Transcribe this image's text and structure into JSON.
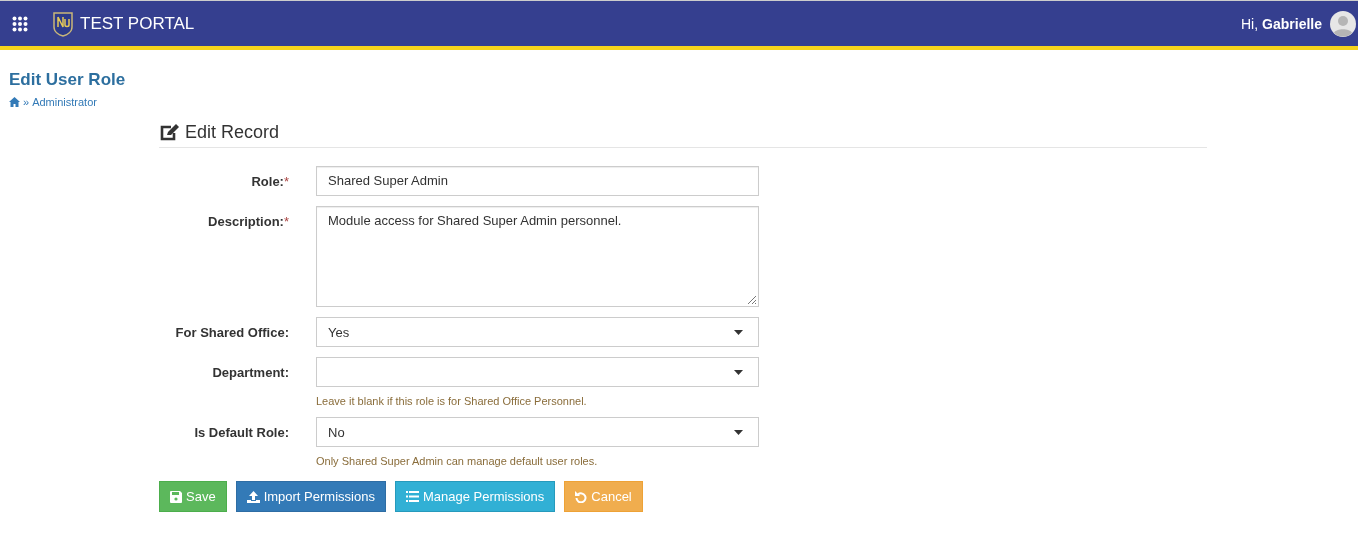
{
  "header": {
    "brand": "TEST PORTAL",
    "greeting": "Hi,",
    "user": "Gabrielle"
  },
  "page": {
    "title": "Edit User Role",
    "breadcrumb_separator": "»",
    "breadcrumb": [
      "Administrator"
    ]
  },
  "section": {
    "title": "Edit Record"
  },
  "fields": [
    {
      "kind": "input",
      "label": "Role:",
      "required_mark": "*",
      "value": "Shared Super Admin"
    },
    {
      "kind": "textarea",
      "label": "Description:",
      "required_mark": "*",
      "value": "Module access for Shared Super Admin personnel."
    },
    {
      "kind": "select",
      "label": "For Shared Office:",
      "value": "Yes"
    },
    {
      "kind": "select",
      "label": "Department:",
      "help": "Leave it blank if this role is for Shared Office Personnel."
    },
    {
      "kind": "select",
      "label": "Is Default Role:",
      "value": "No",
      "help": "Only Shared Super Admin can manage default user roles."
    }
  ],
  "buttons": [
    {
      "kind": "save",
      "label": "Save"
    },
    {
      "kind": "import",
      "label": "Import Permissions"
    },
    {
      "kind": "manage",
      "label": "Manage Permissions"
    },
    {
      "kind": "cancel",
      "label": "Cancel"
    }
  ]
}
